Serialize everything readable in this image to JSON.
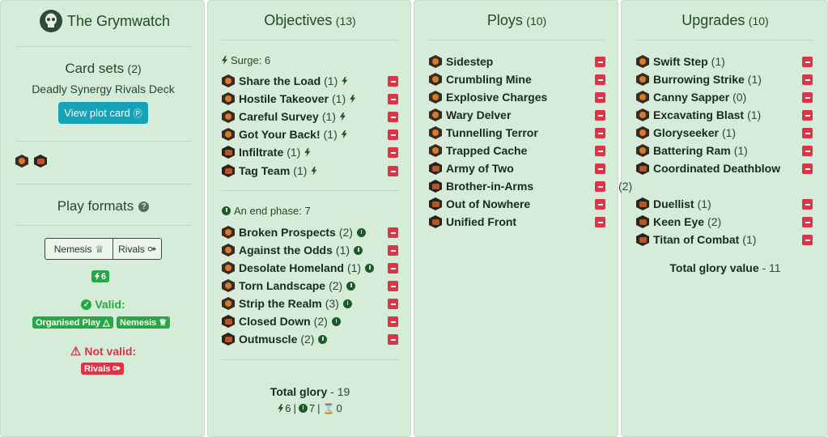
{
  "app": {
    "title": "The Grymwatch"
  },
  "card_sets": {
    "title": "Card sets",
    "count": "(2)",
    "deck": "Deadly Synergy Rivals Deck",
    "view_plot_label": "View plot card"
  },
  "play_formats": {
    "title": "Play formats",
    "nemesis_label": "Nemesis",
    "rivals_label": "Rivals",
    "surge_badge": "6",
    "valid_label": "Valid:",
    "valid_tags": [
      "Organised Play",
      "Nemesis"
    ],
    "invalid_label": "Not valid:",
    "invalid_tags": [
      "Rivals"
    ]
  },
  "objectives": {
    "title": "Objectives",
    "count": "(13)",
    "surge_label": "Surge: 6",
    "end_label": "An end phase: 7",
    "surge_cards": [
      {
        "name": "Share the Load",
        "qty": "(1)"
      },
      {
        "name": "Hostile Takeover",
        "qty": "(1)"
      },
      {
        "name": "Careful Survey",
        "qty": "(1)"
      },
      {
        "name": "Got Your Back!",
        "qty": "(1)"
      },
      {
        "name": "Infiltrate",
        "qty": "(1)"
      },
      {
        "name": "Tag Team",
        "qty": "(1)"
      }
    ],
    "end_cards": [
      {
        "name": "Broken Prospects",
        "qty": "(2)"
      },
      {
        "name": "Against the Odds",
        "qty": "(1)"
      },
      {
        "name": "Desolate Homeland",
        "qty": "(1)"
      },
      {
        "name": "Torn Landscape",
        "qty": "(2)"
      },
      {
        "name": "Strip the Realm",
        "qty": "(3)"
      },
      {
        "name": "Closed Down",
        "qty": "(2)"
      },
      {
        "name": "Outmuscle",
        "qty": "(2)"
      }
    ],
    "total_label": "Total glory",
    "total_value": "- 19",
    "breakdown": {
      "surge": "6",
      "end": "7",
      "third": "0",
      "sep": "|"
    }
  },
  "ploys": {
    "title": "Ploys",
    "count": "(10)",
    "cards": [
      "Sidestep",
      "Crumbling Mine",
      "Explosive Charges",
      "Wary Delver",
      "Tunnelling Terror",
      "Trapped Cache",
      "Army of Two",
      "Brother-in-Arms",
      "Out of Nowhere",
      "Unified Front"
    ]
  },
  "upgrades": {
    "title": "Upgrades",
    "count": "(10)",
    "cards": [
      {
        "name": "Swift Step",
        "qty": "(1)"
      },
      {
        "name": "Burrowing Strike",
        "qty": "(1)"
      },
      {
        "name": "Canny Sapper",
        "qty": "(0)"
      },
      {
        "name": "Excavating Blast",
        "qty": "(1)"
      },
      {
        "name": "Gloryseeker",
        "qty": "(1)"
      },
      {
        "name": "Battering Ram",
        "qty": "(1)"
      },
      {
        "name": "Coordinated Deathblow",
        "qty": "(2)"
      },
      {
        "name": "Duellist",
        "qty": "(1)"
      },
      {
        "name": "Keen Eye",
        "qty": "(2)"
      },
      {
        "name": "Titan of Combat",
        "qty": "(1)"
      }
    ],
    "total_label": "Total glory value",
    "total_value": "- 11"
  }
}
